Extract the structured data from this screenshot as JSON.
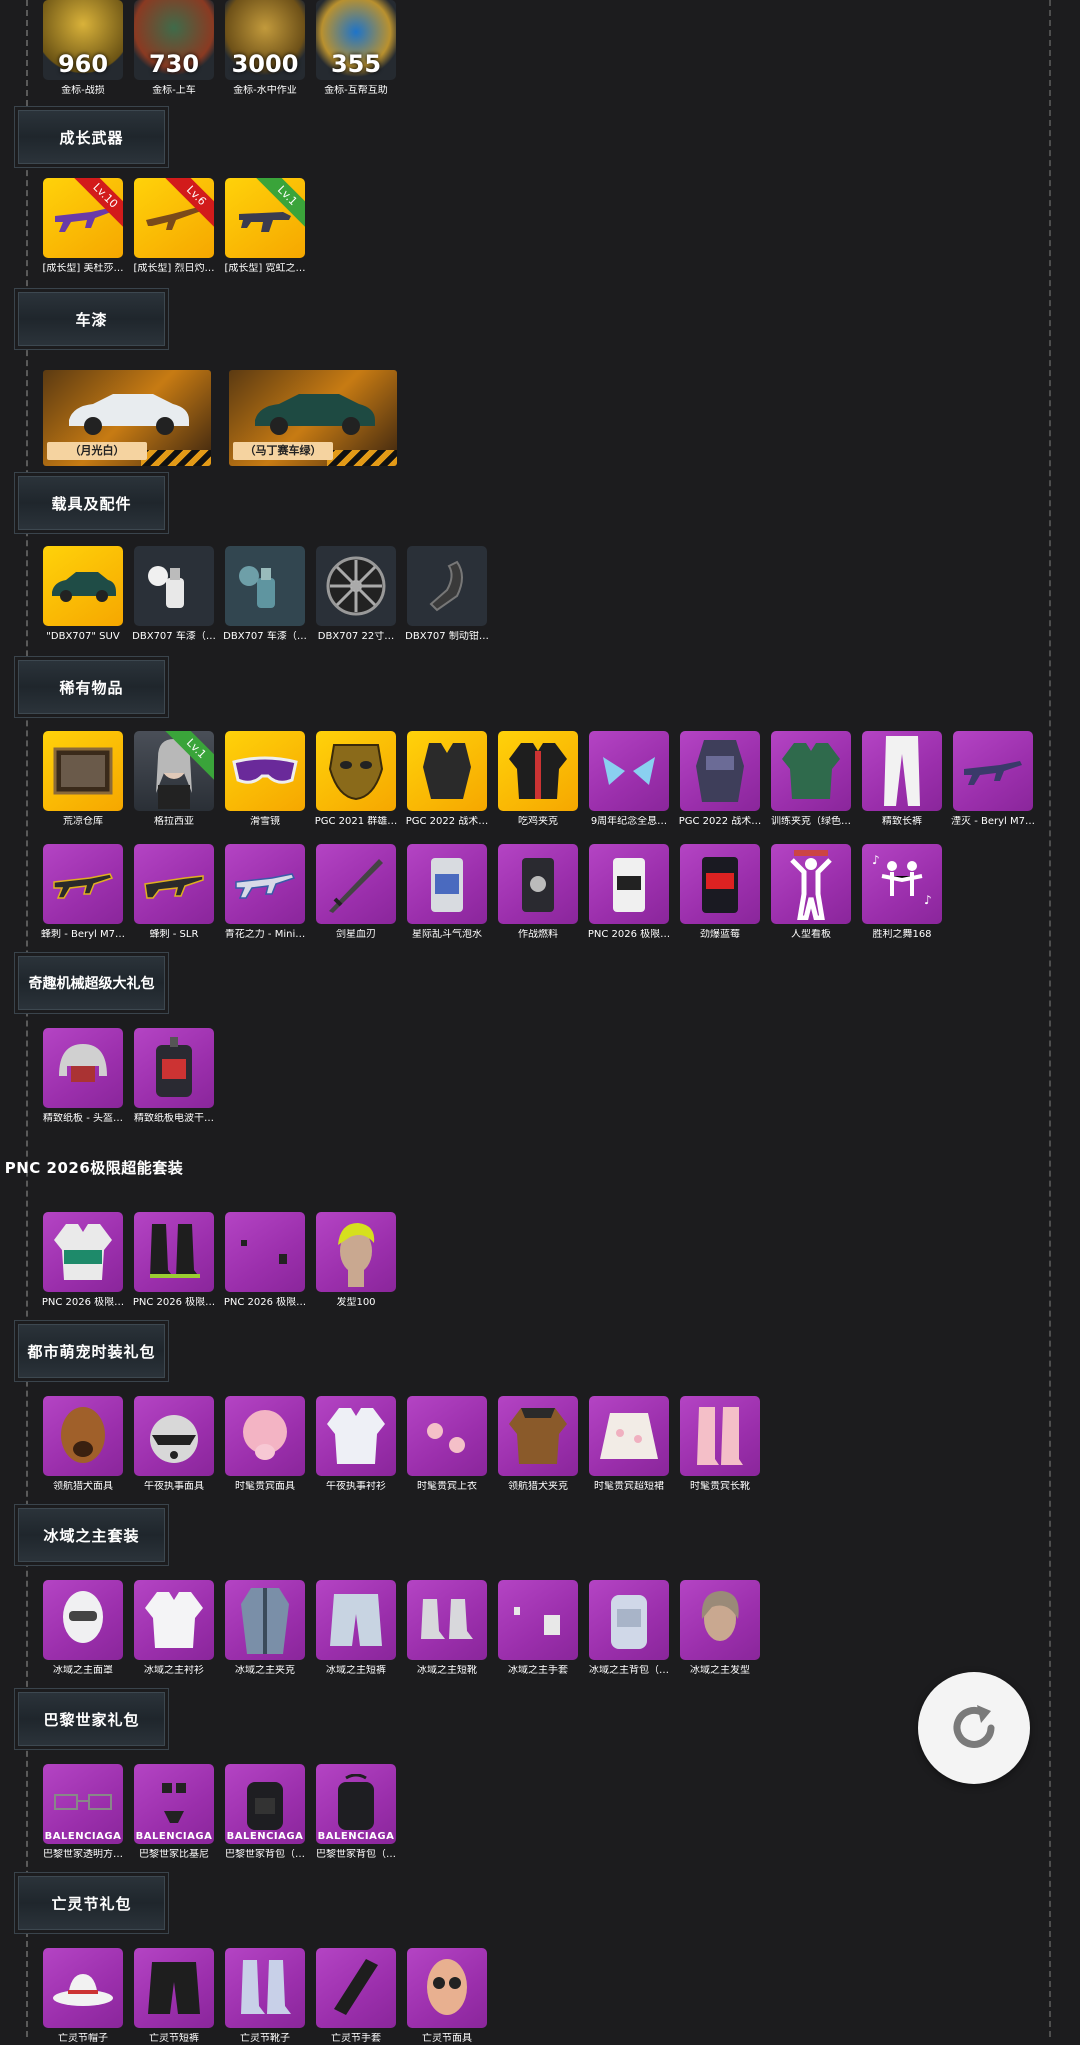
{
  "medals": [
    {
      "value": "960",
      "label": "金标-战损"
    },
    {
      "value": "730",
      "label": "金标-上车"
    },
    {
      "value": "3000",
      "label": "金标-水中作业"
    },
    {
      "value": "355",
      "label": "金标-互帮互助"
    }
  ],
  "sections": {
    "growth_weapons": {
      "title": "成长武器",
      "items": [
        {
          "label": "[成长型] 美杜莎…",
          "level": "Lv.10"
        },
        {
          "label": "[成长型] 烈日灼…",
          "level": "Lv.6"
        },
        {
          "label": "[成长型] 霓虹之…",
          "level": "Lv.1"
        }
      ]
    },
    "car_paint": {
      "title": "车漆",
      "items": [
        {
          "label": "（月光白）"
        },
        {
          "label": "（马丁赛车绿）"
        }
      ]
    },
    "vehicles": {
      "title": "载具及配件",
      "items": [
        {
          "label": "\"DBX707\" SUV"
        },
        {
          "label": "DBX707 车漆（…"
        },
        {
          "label": "DBX707 车漆（…"
        },
        {
          "label": "DBX707 22寸…"
        },
        {
          "label": "DBX707 制动钳…"
        }
      ]
    },
    "rare_items": {
      "title": "稀有物品",
      "row1": [
        {
          "label": "荒凉仓库"
        },
        {
          "label": "格拉西亚",
          "level": "Lv.1"
        },
        {
          "label": "滑雪镜"
        },
        {
          "label": "PGC 2021 群雄…"
        },
        {
          "label": "PGC 2022 战术…"
        },
        {
          "label": "吃鸡夹克"
        },
        {
          "label": "9周年纪念全息…"
        },
        {
          "label": "PGC 2022 战术…"
        },
        {
          "label": "训练夹克（绿色…"
        },
        {
          "label": "精致长裤"
        },
        {
          "label": "湮灭 - Beryl M7…"
        }
      ],
      "row2": [
        {
          "label": "蜂刺 - Beryl M7…"
        },
        {
          "label": "蜂刺 - SLR"
        },
        {
          "label": "青花之力 - Mini…"
        },
        {
          "label": "剑星血刃"
        },
        {
          "label": "星际乱斗气泡水"
        },
        {
          "label": "作战燃料"
        },
        {
          "label": "PNC 2026 极限…"
        },
        {
          "label": "劲爆蓝莓"
        },
        {
          "label": "人型看板"
        },
        {
          "label": "胜利之舞168"
        }
      ]
    },
    "mech_pack": {
      "title": "奇趣机械超级大礼包",
      "items": [
        {
          "label": "精致纸板 - 头盔…"
        },
        {
          "label": "精致纸板电波干…"
        }
      ]
    },
    "pnc_suit": {
      "title": "PNC 2026极限超能套装",
      "items": [
        {
          "label": "PNC 2026 极限…"
        },
        {
          "label": "PNC 2026 极限…"
        },
        {
          "label": "PNC 2026 极限…"
        },
        {
          "label": "发型100"
        }
      ]
    },
    "city_pet": {
      "title": "都市萌宠时装礼包",
      "items": [
        {
          "label": "领航猎犬面具"
        },
        {
          "label": "午夜执事面具"
        },
        {
          "label": "时髦贵宾面具"
        },
        {
          "label": "午夜执事衬衫"
        },
        {
          "label": "时髦贵宾上衣"
        },
        {
          "label": "领航猎犬夹克"
        },
        {
          "label": "时髦贵宾超短裙"
        },
        {
          "label": "时髦贵宾长靴"
        }
      ]
    },
    "ice_lord": {
      "title": "冰域之主套装",
      "items": [
        {
          "label": "冰域之主面罩"
        },
        {
          "label": "冰域之主衬衫"
        },
        {
          "label": "冰域之主夹克"
        },
        {
          "label": "冰域之主短裤"
        },
        {
          "label": "冰域之主短靴"
        },
        {
          "label": "冰域之主手套"
        },
        {
          "label": "冰域之主背包（…"
        },
        {
          "label": "冰域之主发型"
        }
      ]
    },
    "balenciaga": {
      "title": "巴黎世家礼包",
      "brand": "BALENCIAGA",
      "items": [
        {
          "label": "巴黎世家透明方…"
        },
        {
          "label": "巴黎世家比基尼"
        },
        {
          "label": "巴黎世家背包（…"
        },
        {
          "label": "巴黎世家背包（…"
        }
      ]
    },
    "day_of_dead": {
      "title": "亡灵节礼包",
      "items": [
        {
          "label": "亡灵节帽子"
        },
        {
          "label": "亡灵节短裤"
        },
        {
          "label": "亡灵节靴子"
        },
        {
          "label": "亡灵节手套"
        },
        {
          "label": "亡灵节面具"
        }
      ]
    }
  },
  "colors": {
    "background": "#1c1c1e",
    "tile_purple": "#a93bb9",
    "tile_gold": "#f9c100",
    "ribbon_red": "#d21b1b",
    "ribbon_green": "#3aa43a"
  },
  "icons": {
    "refresh": "refresh-icon"
  }
}
